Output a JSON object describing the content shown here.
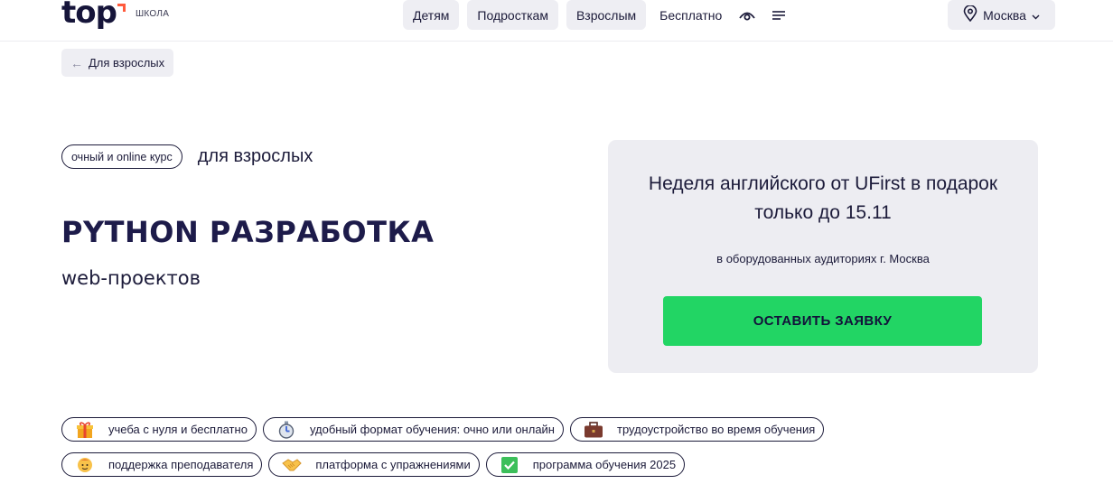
{
  "header": {
    "logo_word": "top",
    "logo_sub": "ШКОЛА",
    "nav": [
      {
        "label": "Детям"
      },
      {
        "label": "Подросткам"
      },
      {
        "label": "Взрослым"
      },
      {
        "label": "Бесплатно"
      }
    ],
    "icons": [
      "eye-icon",
      "menu-icon"
    ],
    "city": "Москва"
  },
  "breadcrumb": {
    "back_label": "Для взрослых"
  },
  "hero": {
    "format_chip": "очный и online курс",
    "audience": "для взрослых",
    "title": "PYTHON РАЗРАБОТКА",
    "subtitle": "web-проектов"
  },
  "promo": {
    "title_line1": "Неделя английского от UFirst в подарок",
    "title_line2": "только до 15.11",
    "note": "в оборудованных аудиториях г. Москва",
    "cta_label": "ОСТАВИТЬ ЗАЯВКУ"
  },
  "features": [
    {
      "label": "учеба с нуля и бесплатно",
      "icon": "gift-icon"
    },
    {
      "label": "удобный формат обучения: очно или онлайн",
      "icon": "stopwatch-icon"
    },
    {
      "label": "трудоустройство во время обучения",
      "icon": "briefcase-icon"
    },
    {
      "label": "поддержка преподавателя",
      "icon": "teacher-icon"
    },
    {
      "label": "платформа с упражнениями",
      "icon": "handshake-icon"
    },
    {
      "label": "программа обучения 2025",
      "icon": "checkmark-icon"
    }
  ],
  "colors": {
    "accent": "#22d564",
    "logo_mark": "#ff5a3c",
    "text": "#1c1b3a",
    "pill_bg": "#eeeef3"
  }
}
